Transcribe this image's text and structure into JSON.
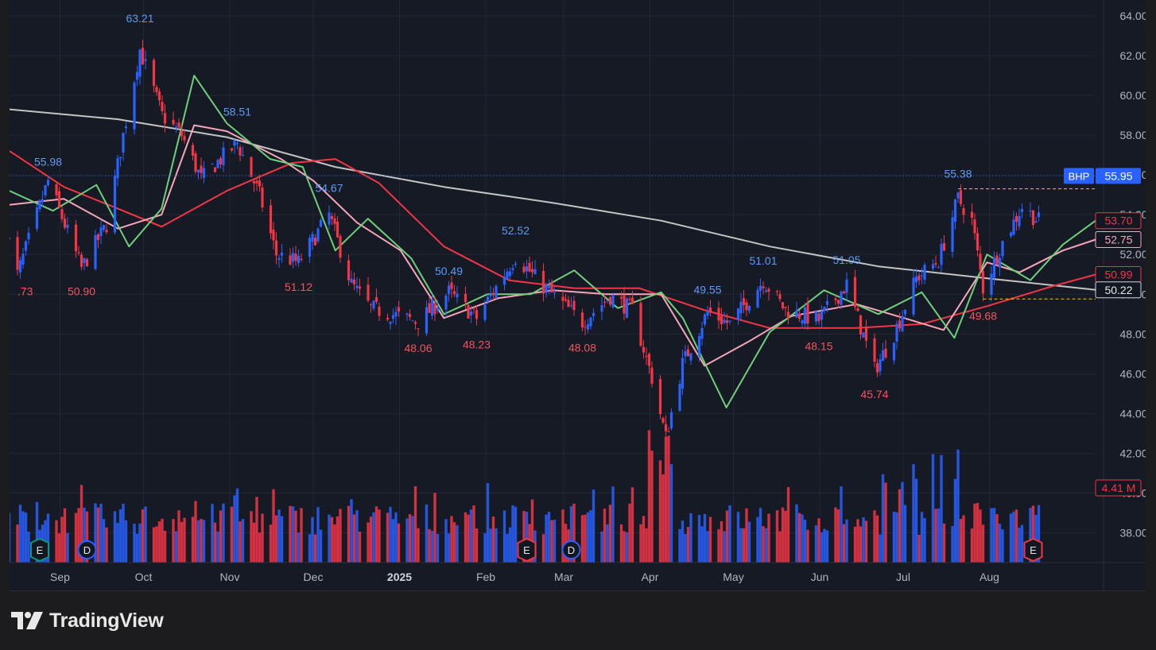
{
  "chart_data": {
    "type": "candlestick",
    "ticker": "BHP",
    "last_price": "55.95",
    "x_labels": [
      "Sep",
      "Oct",
      "Nov",
      "Dec",
      "2025",
      "Feb",
      "Mar",
      "Apr",
      "May",
      "Jun",
      "Jul",
      "Aug"
    ],
    "y_ticks": [
      "64.00",
      "62.00",
      "60.00",
      "58.00",
      "56.00",
      "54.00",
      "52.00",
      "50.00",
      "48.00",
      "46.00",
      "44.00",
      "42.00",
      "40.00",
      "38.00"
    ],
    "ylim": [
      36.5,
      64.8
    ],
    "price_tags": [
      {
        "value": "53.70",
        "color": "#f23645"
      },
      {
        "value": "52.75",
        "color": "#f7a6b8"
      },
      {
        "value": "50.99",
        "color": "#f23645"
      },
      {
        "value": "50.22",
        "color": "#d1d4dc"
      }
    ],
    "volume_tag": "4.41 M",
    "high_low_labels": [
      {
        "text": ".73",
        "kind": "low",
        "price": 50.9,
        "date": "2024-08-19"
      },
      {
        "text": "55.98",
        "kind": "high",
        "price": 55.98,
        "date": "2024-08-30"
      },
      {
        "text": "50.90",
        "kind": "low",
        "price": 50.9,
        "date": "2024-09-11"
      },
      {
        "text": "63.21",
        "kind": "high",
        "price": 63.21,
        "date": "2024-10-02"
      },
      {
        "text": "58.51",
        "kind": "high",
        "price": 58.51,
        "date": "2024-11-06"
      },
      {
        "text": "51.12",
        "kind": "low",
        "price": 51.12,
        "date": "2024-11-28"
      },
      {
        "text": "54.67",
        "kind": "high",
        "price": 54.67,
        "date": "2024-12-09"
      },
      {
        "text": "48.06",
        "kind": "low",
        "price": 48.06,
        "date": "2025-01-10"
      },
      {
        "text": "50.49",
        "kind": "high",
        "price": 50.49,
        "date": "2025-01-21"
      },
      {
        "text": "48.23",
        "kind": "low",
        "price": 48.23,
        "date": "2025-01-31"
      },
      {
        "text": "52.52",
        "kind": "high",
        "price": 52.52,
        "date": "2025-02-14"
      },
      {
        "text": "48.08",
        "kind": "low",
        "price": 48.08,
        "date": "2025-03-10"
      },
      {
        "text": "49.55",
        "kind": "high",
        "price": 49.55,
        "date": "2025-04-24"
      },
      {
        "text": "51.01",
        "kind": "high",
        "price": 51.01,
        "date": "2025-05-14"
      },
      {
        "text": "48.15",
        "kind": "low",
        "price": 48.15,
        "date": "2025-06-03"
      },
      {
        "text": "51.05",
        "kind": "high",
        "price": 51.05,
        "date": "2025-06-13"
      },
      {
        "text": "45.74",
        "kind": "low",
        "price": 45.74,
        "date": "2025-06-23"
      },
      {
        "text": "55.38",
        "kind": "high",
        "price": 55.38,
        "date": "2025-07-23"
      },
      {
        "text": "49.68",
        "kind": "low",
        "price": 49.68,
        "date": "2025-08-01"
      }
    ],
    "event_badges": [
      {
        "letter": "E",
        "date": "2024-08-27",
        "color": "#089981"
      },
      {
        "letter": "D",
        "date": "2024-09-13",
        "color": "#2962ff"
      },
      {
        "letter": "E",
        "date": "2025-02-18",
        "color": "#f23645"
      },
      {
        "letter": "D",
        "date": "2025-03-06",
        "color": "#2962ff"
      },
      {
        "letter": "E",
        "date": "2025-08-19",
        "color": "#f23645"
      }
    ],
    "series": [
      {
        "color": "#c4c4c4",
        "kind": "moving-average",
        "values": [
          [
            0,
            59.3
          ],
          [
            0.1,
            58.8
          ],
          [
            0.2,
            57.9
          ],
          [
            0.3,
            56.4
          ],
          [
            0.4,
            55.4
          ],
          [
            0.5,
            54.6
          ],
          [
            0.6,
            53.7
          ],
          [
            0.7,
            52.4
          ],
          [
            0.8,
            51.4
          ],
          [
            0.9,
            50.8
          ],
          [
            1,
            50.22
          ]
        ]
      },
      {
        "color": "#f23645",
        "kind": "moving-average",
        "values": [
          [
            0,
            57.2
          ],
          [
            0.05,
            55.4
          ],
          [
            0.1,
            54.3
          ],
          [
            0.14,
            53.4
          ],
          [
            0.2,
            55.2
          ],
          [
            0.26,
            56.6
          ],
          [
            0.3,
            56.8
          ],
          [
            0.34,
            55.6
          ],
          [
            0.4,
            52.4
          ],
          [
            0.46,
            50.7
          ],
          [
            0.52,
            50.3
          ],
          [
            0.58,
            50.3
          ],
          [
            0.64,
            49.2
          ],
          [
            0.7,
            48.3
          ],
          [
            0.78,
            48.3
          ],
          [
            0.84,
            48.5
          ],
          [
            0.9,
            49.4
          ],
          [
            0.96,
            50.4
          ],
          [
            1,
            50.99
          ]
        ]
      },
      {
        "color": "#f7a6b8",
        "kind": "moving-average",
        "values": [
          [
            0,
            54.5
          ],
          [
            0.05,
            54.8
          ],
          [
            0.1,
            53.3
          ],
          [
            0.14,
            54.0
          ],
          [
            0.17,
            58.5
          ],
          [
            0.2,
            58.2
          ],
          [
            0.25,
            56.8
          ],
          [
            0.28,
            55.7
          ],
          [
            0.32,
            53.6
          ],
          [
            0.36,
            52.2
          ],
          [
            0.4,
            48.8
          ],
          [
            0.45,
            49.8
          ],
          [
            0.5,
            50.2
          ],
          [
            0.55,
            50.0
          ],
          [
            0.6,
            50.0
          ],
          [
            0.64,
            46.4
          ],
          [
            0.68,
            47.6
          ],
          [
            0.72,
            48.9
          ],
          [
            0.78,
            49.5
          ],
          [
            0.83,
            48.7
          ],
          [
            0.86,
            48.2
          ],
          [
            0.9,
            51.6
          ],
          [
            0.93,
            51.1
          ],
          [
            0.97,
            52.2
          ],
          [
            1,
            52.75
          ]
        ]
      },
      {
        "color": "#6fcf7b",
        "kind": "moving-average",
        "values": [
          [
            0,
            55.2
          ],
          [
            0.04,
            54.2
          ],
          [
            0.08,
            55.5
          ],
          [
            0.11,
            52.4
          ],
          [
            0.14,
            54.3
          ],
          [
            0.17,
            61.0
          ],
          [
            0.2,
            58.6
          ],
          [
            0.24,
            56.8
          ],
          [
            0.27,
            56.4
          ],
          [
            0.3,
            52.2
          ],
          [
            0.33,
            53.8
          ],
          [
            0.37,
            51.8
          ],
          [
            0.4,
            49.0
          ],
          [
            0.44,
            50.0
          ],
          [
            0.48,
            50.0
          ],
          [
            0.52,
            51.2
          ],
          [
            0.56,
            49.3
          ],
          [
            0.6,
            50.1
          ],
          [
            0.62,
            48.8
          ],
          [
            0.66,
            44.3
          ],
          [
            0.7,
            48.1
          ],
          [
            0.75,
            50.2
          ],
          [
            0.8,
            49.0
          ],
          [
            0.84,
            50.1
          ],
          [
            0.87,
            47.8
          ],
          [
            0.9,
            52.0
          ],
          [
            0.94,
            50.7
          ],
          [
            0.97,
            52.5
          ],
          [
            1,
            53.7
          ]
        ]
      }
    ],
    "ohlc_sample_window": [
      "2024-08-15",
      "2025-08-21"
    ]
  },
  "branding": {
    "name": "TradingView"
  }
}
